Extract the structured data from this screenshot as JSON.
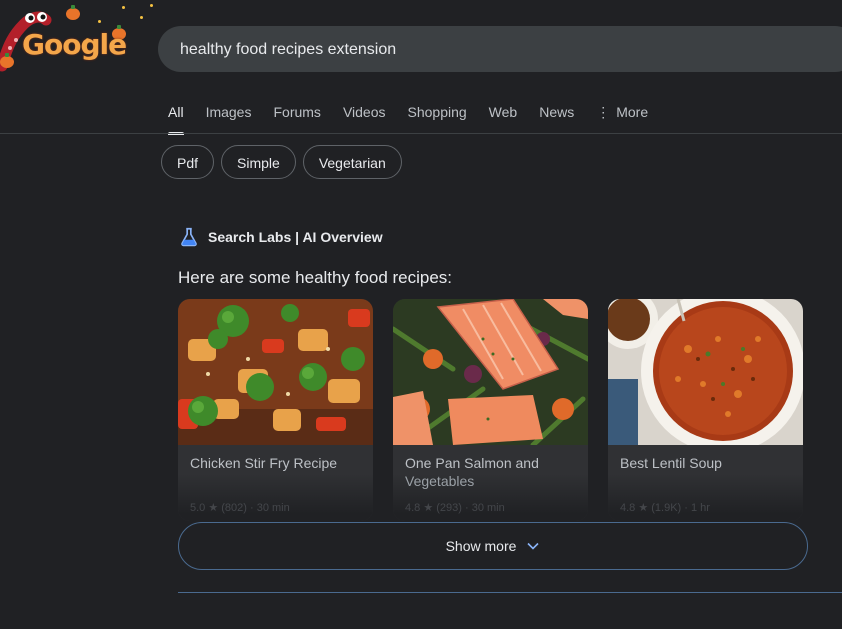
{
  "logo": {
    "text": "Google"
  },
  "search": {
    "query": "healthy food recipes extension"
  },
  "tabs": [
    {
      "label": "All",
      "active": true
    },
    {
      "label": "Images"
    },
    {
      "label": "Forums"
    },
    {
      "label": "Videos"
    },
    {
      "label": "Shopping"
    },
    {
      "label": "Web"
    },
    {
      "label": "News"
    },
    {
      "label": "More",
      "icon": "more-vert-icon"
    }
  ],
  "chips": [
    {
      "label": "Pdf"
    },
    {
      "label": "Simple"
    },
    {
      "label": "Vegetarian"
    }
  ],
  "ai_overview": {
    "icon": "flask-icon",
    "title": "Search Labs | AI Overview",
    "intro": "Here are some healthy food recipes:"
  },
  "cards": [
    {
      "title_line1": "Chicken Stir Fry Recipe",
      "title_line2": "",
      "meta": "5.0 ★ (802) · 30 min"
    },
    {
      "title_line1": "One Pan Salmon and",
      "title_line2": "Vegetables",
      "meta": "4.8 ★ (293) · 30 min"
    },
    {
      "title_line1": "Best Lentil Soup",
      "title_line2": "",
      "meta": "4.8 ★ (1.9K) · 1 hr"
    }
  ],
  "show_more": {
    "label": "Show more",
    "icon": "chevron-down-icon"
  },
  "colors": {
    "background": "#202124",
    "card": "#303134",
    "accent_border": "#4a6a8f"
  }
}
